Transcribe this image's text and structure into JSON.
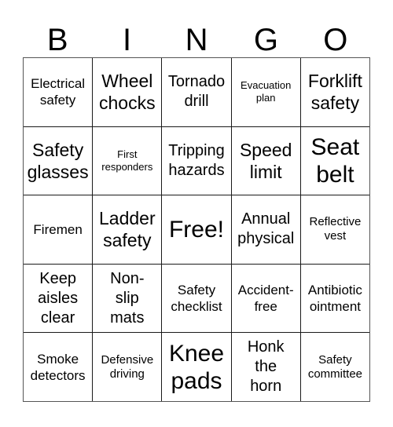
{
  "card": {
    "title_letters": [
      "B",
      "I",
      "N",
      "G",
      "O"
    ],
    "grid": {
      "columns": 5,
      "rows": 5,
      "border_color": "#1a1a1a",
      "outer_border_color": "#555555",
      "background": "#ffffff",
      "text_color": "#000000"
    },
    "cells": [
      [
        {
          "text": "Electrical\nsafety",
          "size": "fs-md"
        },
        {
          "text": "Wheel\nchocks",
          "size": "fs-xl"
        },
        {
          "text": "Tornado\ndrill",
          "size": "fs-lg"
        },
        {
          "text": "Evacuation\nplan",
          "size": "fs-xs"
        },
        {
          "text": "Forklift\nsafety",
          "size": "fs-xl"
        }
      ],
      [
        {
          "text": "Safety\nglasses",
          "size": "fs-xl"
        },
        {
          "text": "First\nresponders",
          "size": "fs-xs"
        },
        {
          "text": "Tripping\nhazards",
          "size": "fs-lg"
        },
        {
          "text": "Speed\nlimit",
          "size": "fs-xl"
        },
        {
          "text": "Seat\nbelt",
          "size": "fs-xxl"
        }
      ],
      [
        {
          "text": "Firemen",
          "size": "fs-md"
        },
        {
          "text": "Ladder\nsafety",
          "size": "fs-xl"
        },
        {
          "text": "Free!",
          "size": "fs-xxl"
        },
        {
          "text": "Annual\nphysical",
          "size": "fs-lg"
        },
        {
          "text": "Reflective\nvest",
          "size": "fs-sm"
        }
      ],
      [
        {
          "text": "Keep\naisles\nclear",
          "size": "fs-lg"
        },
        {
          "text": "Non-\nslip\nmats",
          "size": "fs-lg"
        },
        {
          "text": "Safety\nchecklist",
          "size": "fs-md"
        },
        {
          "text": "Accident-\nfree",
          "size": "fs-md"
        },
        {
          "text": "Antibiotic\nointment",
          "size": "fs-md"
        }
      ],
      [
        {
          "text": "Smoke\ndetectors",
          "size": "fs-md"
        },
        {
          "text": "Defensive\ndriving",
          "size": "fs-sm"
        },
        {
          "text": "Knee\npads",
          "size": "fs-xxl"
        },
        {
          "text": "Honk\nthe\nhorn",
          "size": "fs-lg"
        },
        {
          "text": "Safety\ncommittee",
          "size": "fs-sm"
        }
      ]
    ]
  }
}
